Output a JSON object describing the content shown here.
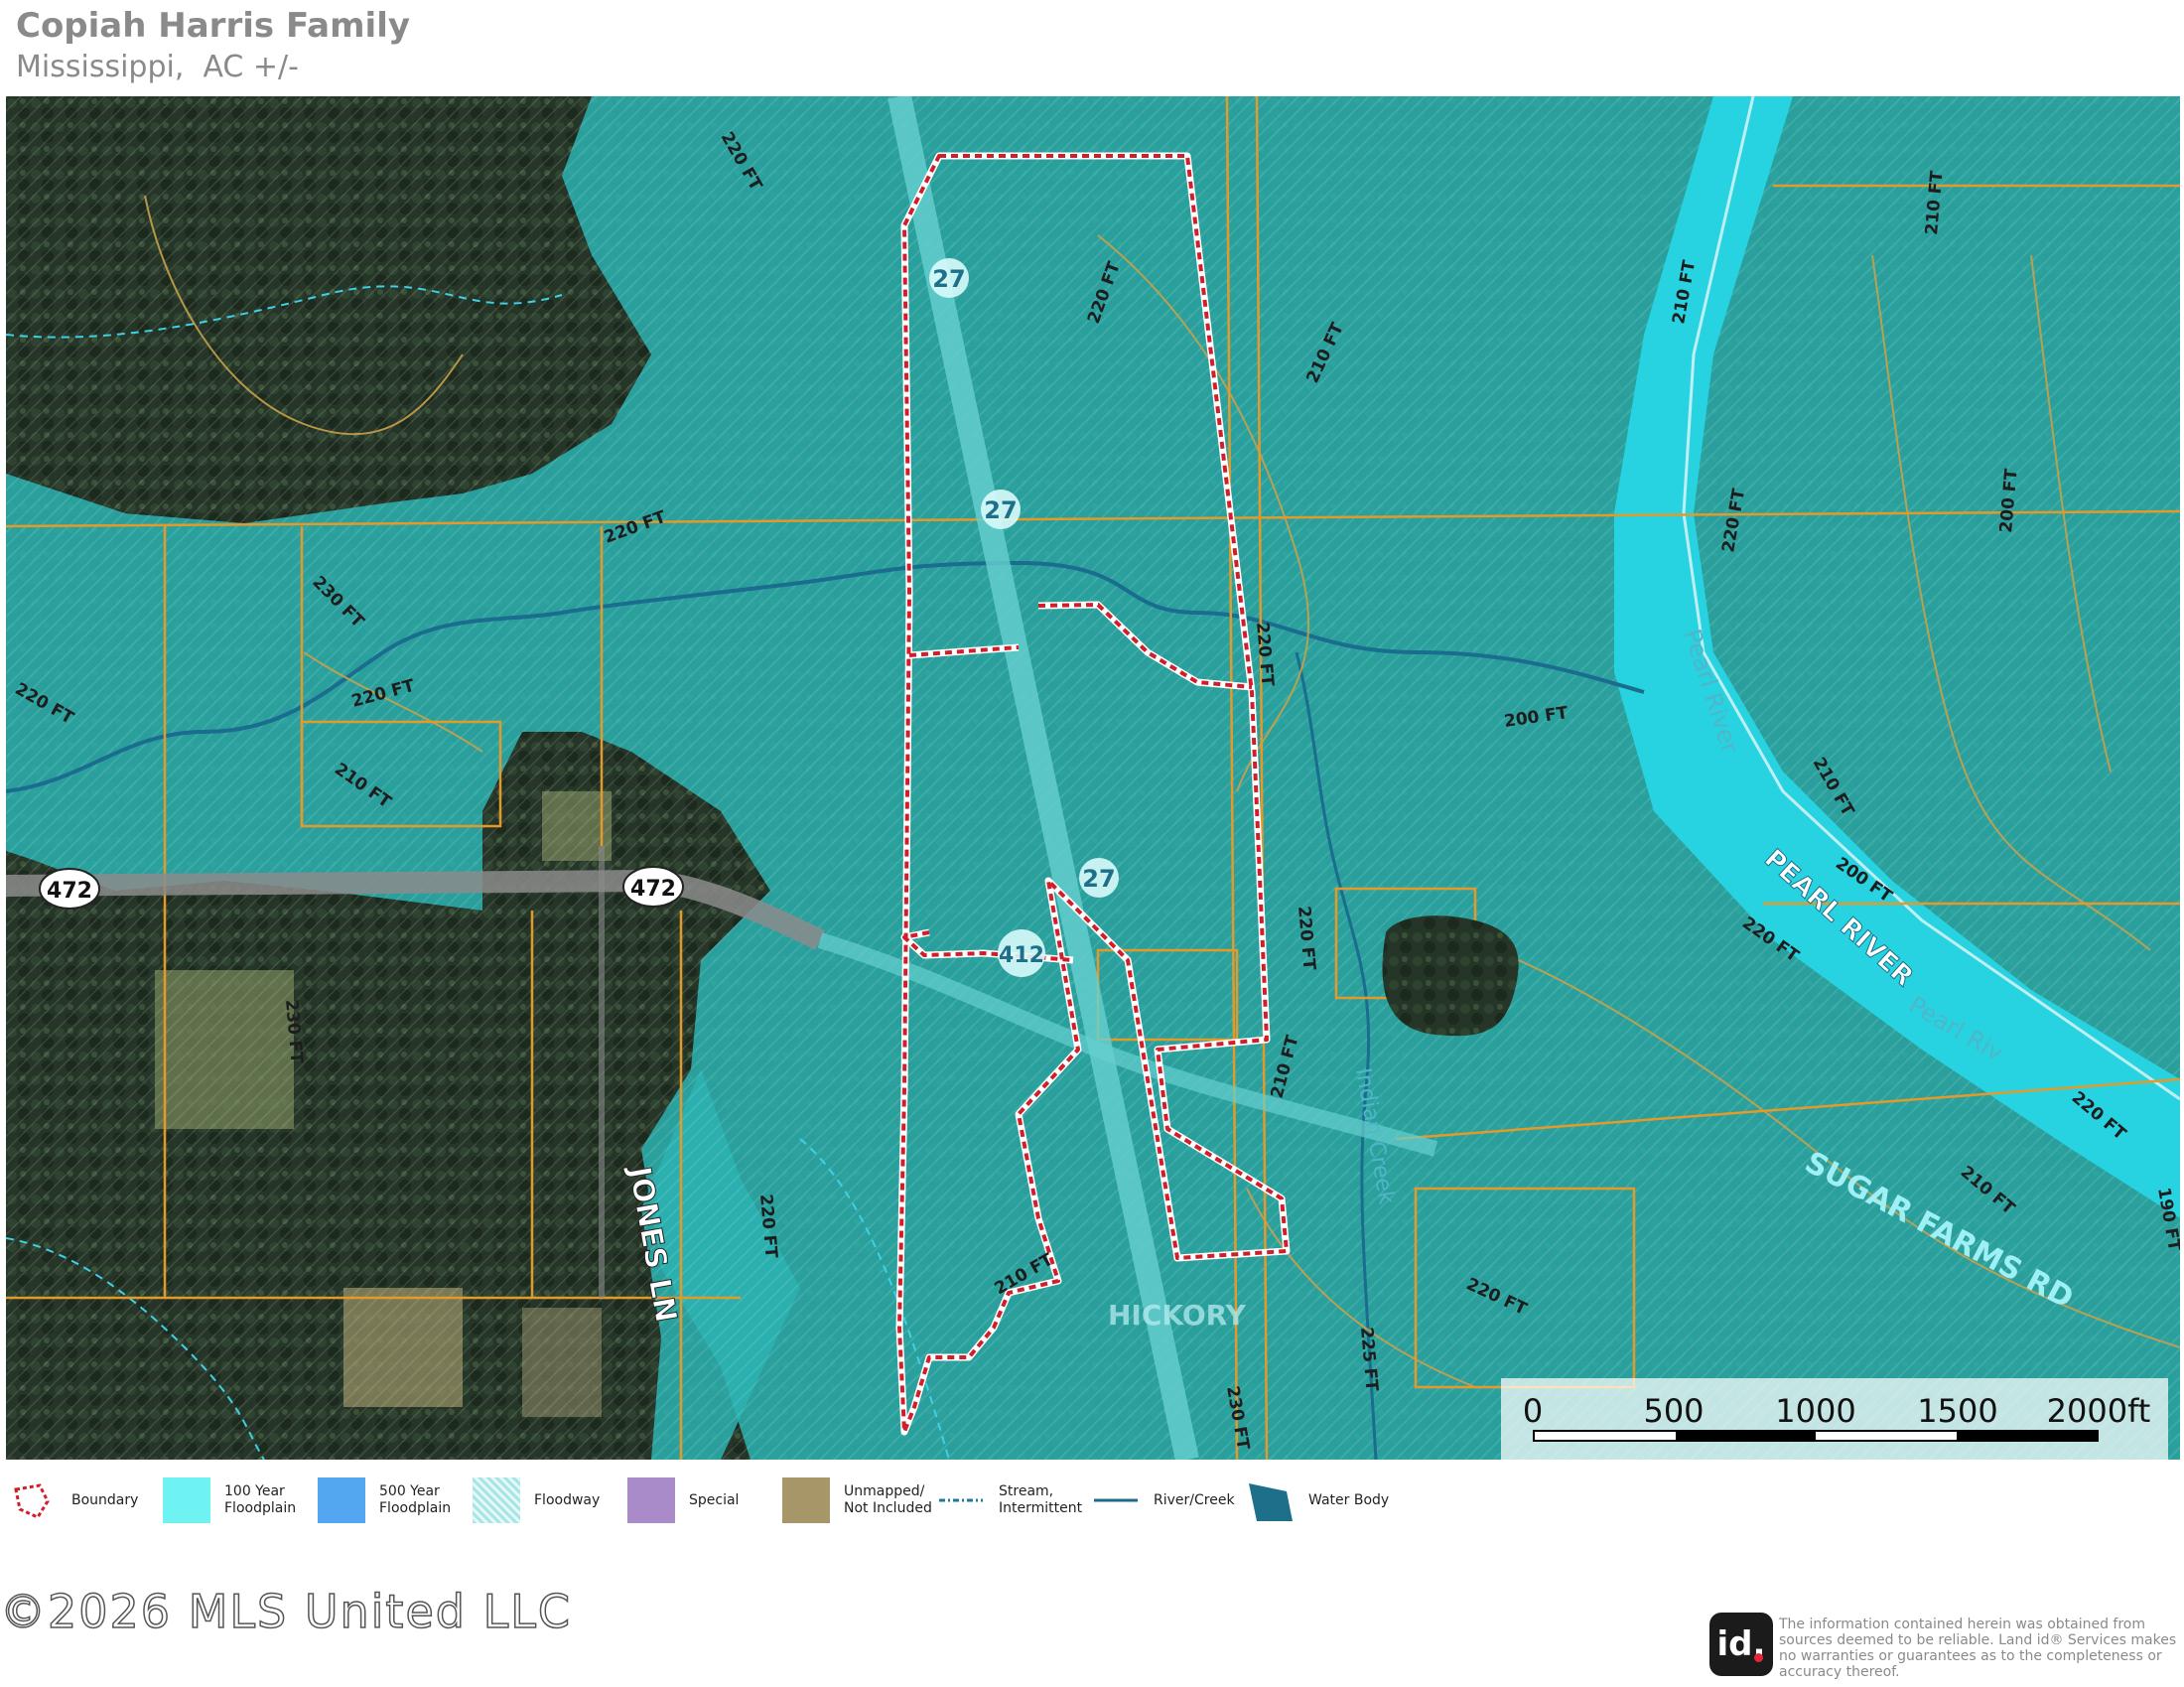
{
  "header": {
    "title": "Copiah Harris Family",
    "subtitle": "Mississippi,  AC +/-"
  },
  "map": {
    "road_shields": [
      "472",
      "472",
      "27",
      "27",
      "27",
      "412"
    ],
    "road_labels": {
      "jones_ln": "JONES LN",
      "pearl_river": "PEARL RIVER",
      "pearl_river_water_1": "Pearl River",
      "pearl_river_water_2": "Pearl Riv",
      "sugar_farms_rd": "SUGAR FARMS RD",
      "indian_creek": "Indian Creek",
      "hickory_town": "HICKORY"
    },
    "contour_labels": [
      "220 FT",
      "220 FT",
      "220 FT",
      "230 FT",
      "220 FT",
      "220 FT",
      "210 FT",
      "220 FT",
      "210 FT",
      "210 FT",
      "200 FT",
      "200 FT",
      "210 FT",
      "220 FT",
      "210 FT",
      "200 FT",
      "220 FT",
      "220 FT",
      "210 FT",
      "190 FT",
      "210 FT",
      "230 FT",
      "220 FT",
      "210 FT",
      "220 FT",
      "225 FT",
      "220 FT",
      "230 FT"
    ],
    "colors": {
      "floodplain": "#2bb3b3",
      "river": "#27d3e0",
      "boundary": "#d01f2a",
      "parcel_lines": "#e39a2a",
      "contour": "#c8a14a"
    }
  },
  "scale_bar": {
    "labels": [
      "0",
      "500",
      "1000",
      "1500",
      "2000ft"
    ]
  },
  "legend": [
    {
      "label": "Boundary",
      "icon": "boundary-icon",
      "color": "#d01f2a"
    },
    {
      "label": "100 Year\nFloodplain",
      "icon": "floodplain-100-icon",
      "color": "#6ff2f2"
    },
    {
      "label": "500 Year\nFloodplain",
      "icon": "floodplain-500-icon",
      "color": "#52a7f0"
    },
    {
      "label": "Floodway",
      "icon": "floodway-icon",
      "color": "#a8e6e6"
    },
    {
      "label": "Special",
      "icon": "special-icon",
      "color": "#a98bc9"
    },
    {
      "label": "Unmapped/\nNot Included",
      "icon": "unmapped-icon",
      "color": "#a69668"
    },
    {
      "label": "Stream,\nIntermittent",
      "icon": "stream-intermittent-icon",
      "color": "#1f7a9a"
    },
    {
      "label": "River/Creek",
      "icon": "river-creek-icon",
      "color": "#1f6a8a"
    },
    {
      "label": "Water Body",
      "icon": "water-body-icon",
      "color": "#1d6f8a"
    }
  ],
  "footer": {
    "copyright": "©2026 MLS United LLC",
    "logo": "id.",
    "disclaimer": "The information contained herein was obtained from sources deemed to be reliable.\n Land id® Services makes no warranties or guarantees as to the completeness or accuracy thereof."
  }
}
